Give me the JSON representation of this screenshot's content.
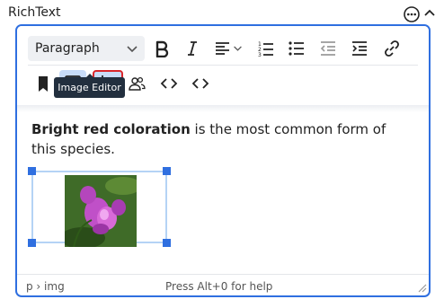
{
  "field": {
    "label": "RichText",
    "more_icon": "ellipsis-circle-icon",
    "collapse_icon": "chevron-up-icon"
  },
  "toolbar": {
    "block_format": "Paragraph",
    "row1_icons": [
      "bold-icon",
      "italic-icon",
      "align-left-icon",
      "numbered-list-icon",
      "bulleted-list-icon",
      "outdent-icon",
      "indent-icon",
      "link-icon"
    ],
    "row2_icons": [
      "bookmark-icon",
      "image-icon",
      "image-editor-icon",
      "users-icon",
      "code-icon",
      "source-code-icon"
    ],
    "tooltip": "Image Editor",
    "accent_color": "#2f6fe0",
    "highlight_color": "#d9262b"
  },
  "content": {
    "bold_text": "Bright red coloration",
    "rest_text": " is the most common form of this species."
  },
  "statusbar": {
    "path": "p › img",
    "help": "Press Alt+0 for help"
  }
}
